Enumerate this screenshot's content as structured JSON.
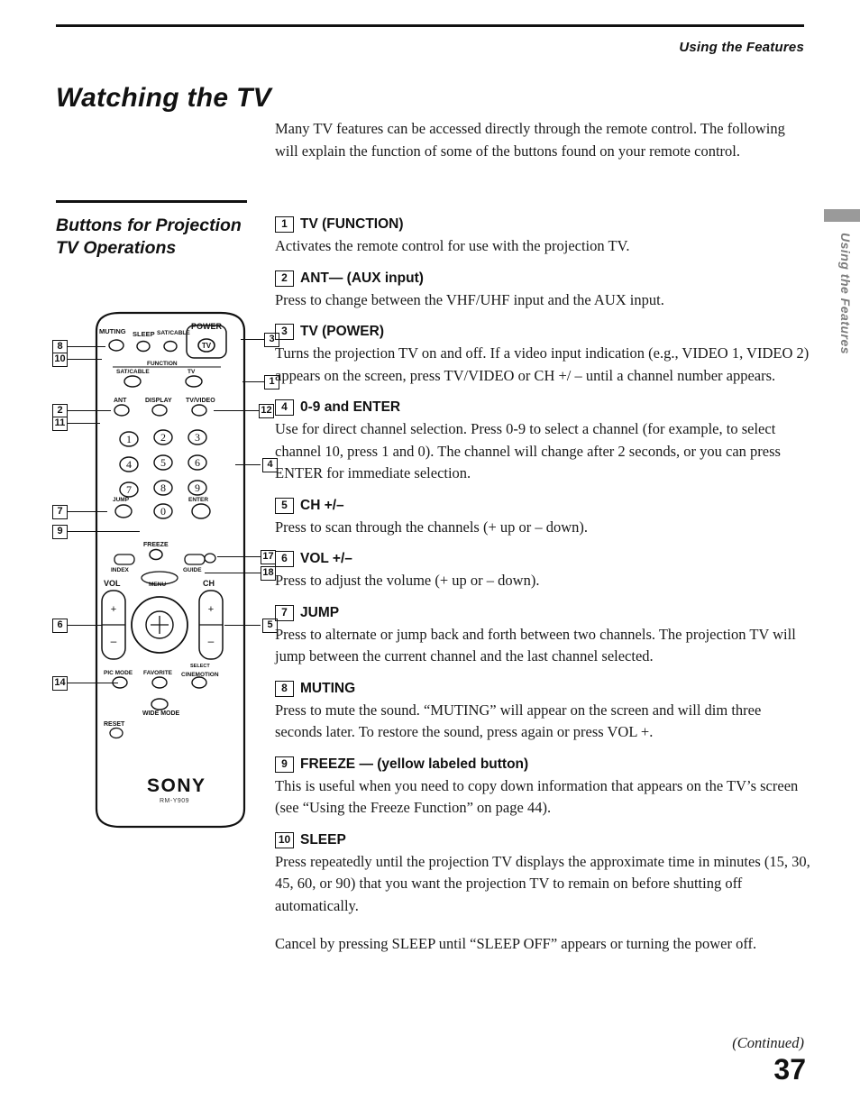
{
  "running_head": "Using the Features",
  "page_title": "Watching the TV",
  "edge_tab_label": "Using the Features",
  "intro": "Many TV features can be accessed directly through the remote control. The following will explain the function of some of the buttons found on your remote control.",
  "sidebar_heading": "Buttons for Projection TV Operations",
  "items": [
    {
      "num": "1",
      "title": "TV (FUNCTION)",
      "body": "Activates the remote control for use with the projection TV."
    },
    {
      "num": "2",
      "title": "ANT— (AUX input)",
      "body": "Press to change between the VHF/UHF input and the AUX input."
    },
    {
      "num": "3",
      "title": "TV (POWER)",
      "body": "Turns the projection TV on and off. If a video input indication (e.g., VIDEO 1, VIDEO 2) appears on the screen, press TV/VIDEO or CH +/ – until a channel number appears."
    },
    {
      "num": "4",
      "title": "0-9 and ENTER",
      "body": "Use for direct channel selection. Press 0-9 to select a channel (for example, to select channel 10, press 1 and 0). The channel will change after 2 seconds, or you can press ENTER for immediate selection."
    },
    {
      "num": "5",
      "title": "CH +/–",
      "body": "Press to scan through the channels (+ up or – down)."
    },
    {
      "num": "6",
      "title": "VOL +/–",
      "body": "Press to adjust the volume (+ up or – down)."
    },
    {
      "num": "7",
      "title": "JUMP",
      "body": "Press to alternate or jump back and forth between two channels. The projection TV will jump between the current channel and the last channel selected."
    },
    {
      "num": "8",
      "title": "MUTING",
      "body": "Press to mute the sound. “MUTING” will appear on the screen and will dim three seconds later. To restore the sound, press again or press VOL +."
    },
    {
      "num": "9",
      "title": "FREEZE — (yellow labeled button)",
      "body": "This is useful when you need to copy down information that appears on the TV’s screen (see “Using the Freeze Function” on page 44)."
    },
    {
      "num": "10",
      "title": "SLEEP",
      "body": "Press repeatedly until the projection TV displays the approximate time in minutes (15, 30, 45, 60, or 90) that you want the projection TV to remain on before shutting off automatically."
    }
  ],
  "closing_paragraph": "Cancel by pressing SLEEP until “SLEEP OFF” appears or turning the power off.",
  "continued": "(Continued)",
  "folio": "37",
  "remote": {
    "brand": "SONY",
    "model": "RM-Y909",
    "labels": {
      "muting": "MUTING",
      "sleep": "SLEEP",
      "sat_cable": "SAT/CABLE",
      "power": "POWER",
      "power_tv": "TV",
      "function": "FUNCTION",
      "satcable2": "SAT/CABLE",
      "tv": "TV",
      "ant": "ANT",
      "display": "DISPLAY",
      "tv_video": "TV/VIDEO",
      "jump": "JUMP",
      "enter": "ENTER",
      "freeze": "FREEZE",
      "index": "INDEX",
      "guide": "GUIDE",
      "menu": "MENU",
      "vol": "VOL",
      "ch": "CH",
      "pic_mode": "PIC MODE",
      "favorite": "FAVORITE",
      "cine_motion": "CINEMOTION",
      "select": "SELECT",
      "wide_mode": "WIDE MODE",
      "reset": "RESET",
      "plus": "+",
      "minus": "–"
    },
    "keypad": [
      "1",
      "2",
      "3",
      "4",
      "5",
      "6",
      "7",
      "8",
      "9",
      "0"
    ],
    "callouts": [
      "1",
      "2",
      "3",
      "4",
      "5",
      "6",
      "7",
      "8",
      "9",
      "10",
      "11",
      "12",
      "14",
      "17",
      "18"
    ]
  }
}
